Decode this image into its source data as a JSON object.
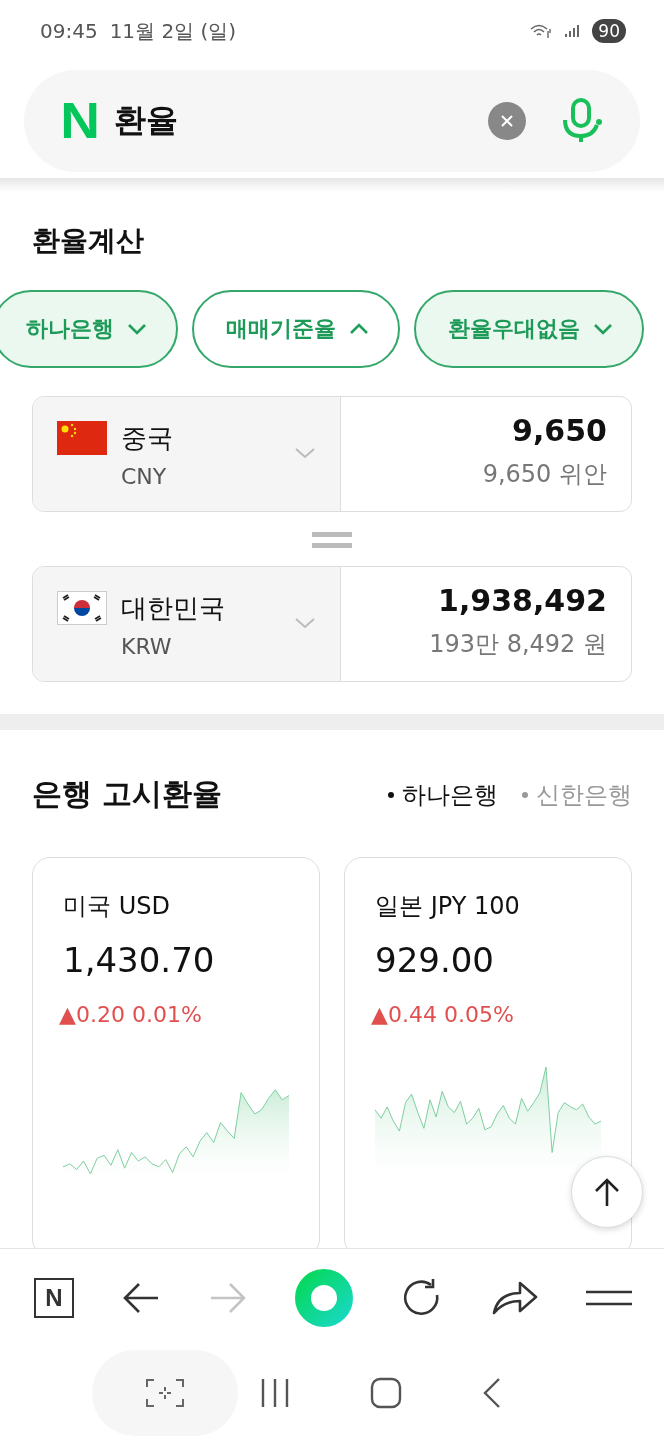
{
  "status_bar": {
    "time": "09:45",
    "date": "11월 2일 (일)",
    "battery": "90"
  },
  "search": {
    "logo": "N",
    "value": "환율"
  },
  "calculator": {
    "title": "환율계산",
    "chips": [
      {
        "label": "하나은행",
        "expanded": false
      },
      {
        "label": "매매기준율",
        "expanded": true
      },
      {
        "label": "환율우대없음",
        "expanded": false
      }
    ],
    "currencies": [
      {
        "country": "중국",
        "code": "CNY",
        "kind": "china",
        "amount": "9,650",
        "reading": "9,650 위안"
      },
      {
        "country": "대한민국",
        "code": "KRW",
        "kind": "korea",
        "amount": "1,938,492",
        "reading": "193만 8,492 원"
      }
    ]
  },
  "bank_rates": {
    "title": "은행 고시환율",
    "banks": [
      {
        "label": "하나은행",
        "selected": true
      },
      {
        "label": "신한은행",
        "selected": false
      }
    ],
    "cards": [
      {
        "name": "미국 USD",
        "rate": "1,430.70",
        "change": "▲0.20 0.01%"
      },
      {
        "name": "일본 JPY 100",
        "rate": "929.00",
        "change": "▲0.44 0.05%"
      }
    ]
  },
  "toolbar": {
    "home_label": "N",
    "forward_disabled": true
  }
}
